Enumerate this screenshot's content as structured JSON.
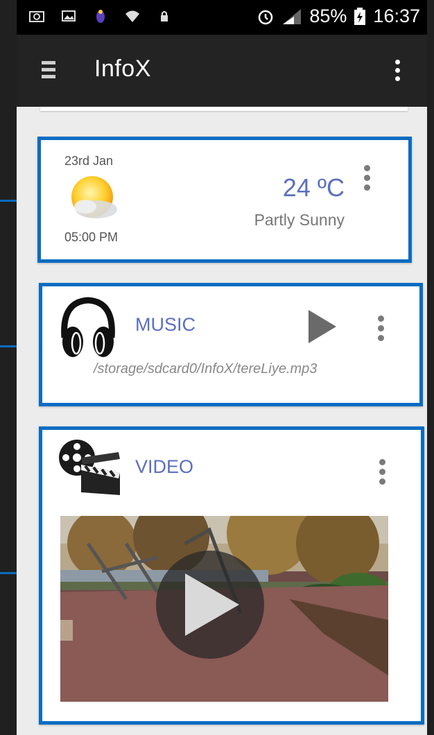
{
  "status_bar": {
    "battery_text": "85%",
    "time": "16:37",
    "icons": [
      "camera-icon",
      "image-icon",
      "app-icon",
      "wifi-icon",
      "lock-icon",
      "alarm-icon",
      "signal-icon",
      "battery-icon"
    ]
  },
  "app_bar": {
    "title": "InfoX",
    "menu_icon": "hamburger-icon",
    "overflow_icon": "more-vert-icon"
  },
  "weather_card": {
    "date": "23rd Jan",
    "time": "05:00 PM",
    "temperature": "24 ºC",
    "condition": "Partly Sunny",
    "icon": "partly-sunny-icon"
  },
  "music_card": {
    "label": "MUSIC",
    "path": "/storage/sdcard0/InfoX/tereLiye.mp3",
    "icon": "headphones-icon"
  },
  "video_card": {
    "label": "VIDEO",
    "icon": "film-reel-icon"
  },
  "colors": {
    "accent_text": "#5c6fc0",
    "highlight_border": "#0a6cc2",
    "app_bar": "#232323"
  }
}
